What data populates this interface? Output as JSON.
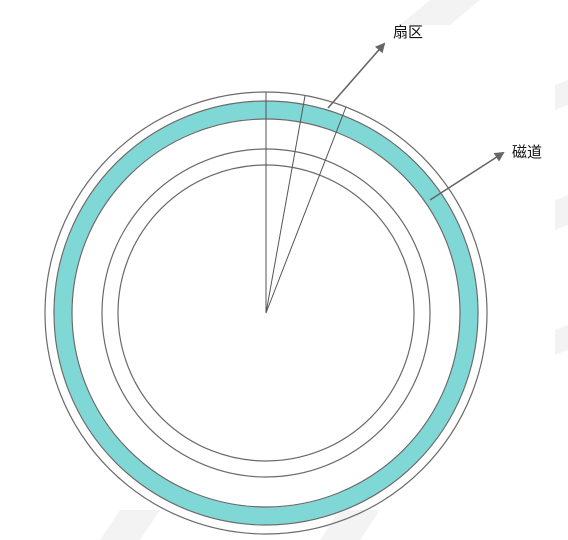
{
  "labels": {
    "sector": "扇区",
    "track": "磁道"
  },
  "colors": {
    "highlighted_track": "#7fd8d6",
    "lines": "#6a6a6a"
  }
}
